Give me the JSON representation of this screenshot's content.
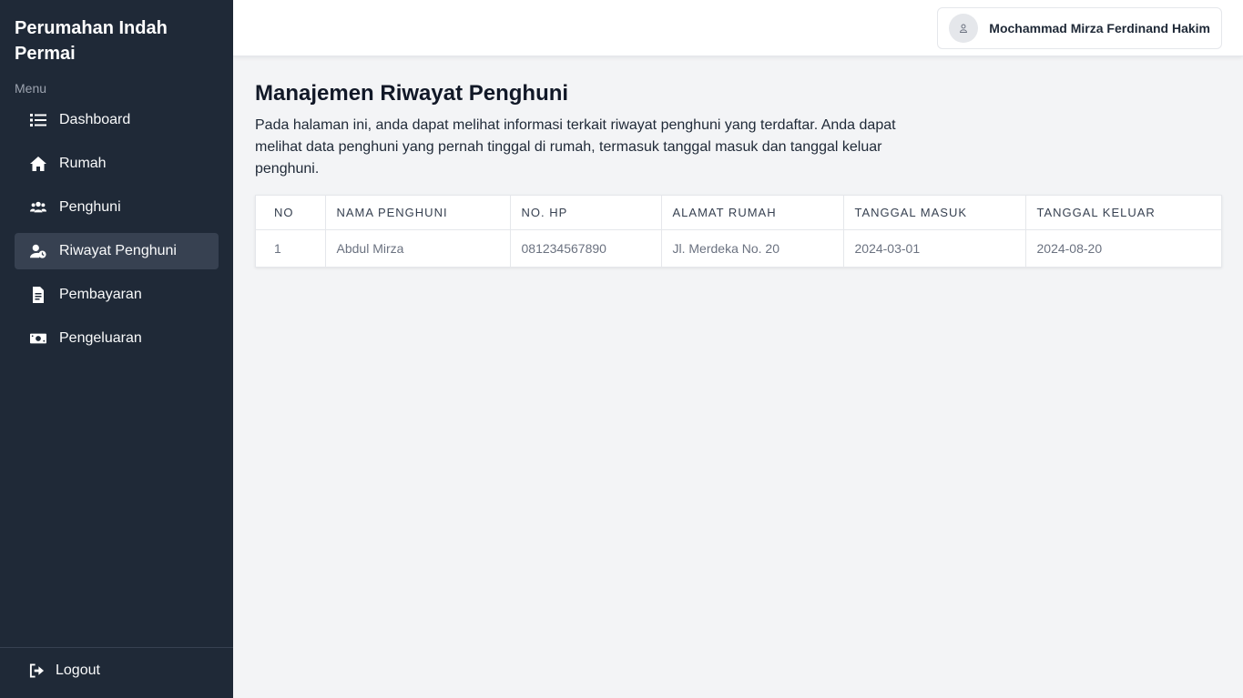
{
  "app": {
    "brand": "Perumahan Indah Permai",
    "menu_label": "Menu"
  },
  "sidebar": {
    "items": [
      {
        "label": "Dashboard",
        "icon": "list-icon",
        "active": false
      },
      {
        "label": "Rumah",
        "icon": "home-icon",
        "active": false
      },
      {
        "label": "Penghuni",
        "icon": "users-icon",
        "active": false
      },
      {
        "label": "Riwayat Penghuni",
        "icon": "user-clock-icon",
        "active": true
      },
      {
        "label": "Pembayaran",
        "icon": "file-invoice-icon",
        "active": false
      },
      {
        "label": "Pengeluaran",
        "icon": "money-bill-icon",
        "active": false
      }
    ],
    "logout_label": "Logout"
  },
  "header": {
    "user_name": "Mochammad Mirza Ferdinand Hakim"
  },
  "main": {
    "title": "Manajemen Riwayat Penghuni",
    "description": "Pada halaman ini, anda dapat melihat informasi terkait riwayat penghuni yang terdaftar. Anda dapat melihat data penghuni yang pernah tinggal di rumah, termasuk tanggal masuk dan tanggal keluar penghuni."
  },
  "table": {
    "headers": [
      "NO",
      "NAMA PENGHUNI",
      "NO. HP",
      "ALAMAT RUMAH",
      "TANGGAL MASUK",
      "TANGGAL KELUAR"
    ],
    "rows": [
      [
        "1",
        "Abdul Mirza",
        "081234567890",
        "Jl. Merdeka No. 20",
        "2024-03-01",
        "2024-08-20"
      ]
    ]
  },
  "colors": {
    "sidebar_bg": "#1f2937",
    "active_item_bg": "#374151",
    "content_bg": "#f3f4f6"
  }
}
